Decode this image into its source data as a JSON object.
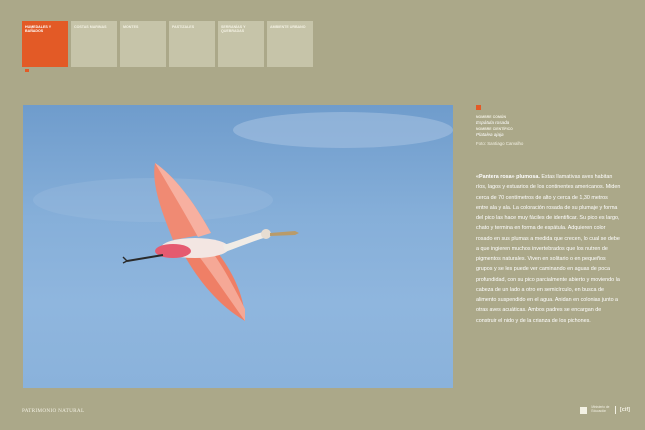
{
  "tabs": [
    {
      "label": "Humedales y bañados",
      "active": true
    },
    {
      "label": "Costas marinas",
      "active": false
    },
    {
      "label": "Montes",
      "active": false
    },
    {
      "label": "Pastizales",
      "active": false
    },
    {
      "label": "Serranías y quebradas",
      "active": false
    },
    {
      "label": "Ambiente urbano",
      "active": false
    }
  ],
  "caption": {
    "common_name_label": "Nombre común",
    "common_name": "Espátula rosada",
    "scientific_name_label": "Nombre científico",
    "scientific_name": "Platalea ajaja",
    "photo_credit": "Foto: Santiago Carvalho"
  },
  "description": {
    "lead": "«Pantera rosa» plumosa.",
    "text": " Estas llamativas aves habitan ríos, lagos y estuarios de los continentes americanos. Miden cerca de 70 centímetros de alto y cerca de 1,30 metros entre ala y ala. La coloración rosada de su plumaje y forma del pico las hace muy fáciles de identificar. Su pico es largo, chato y termina en forma de espátula. Adquieren color rosado en sus plumas a medida que crecen, lo cual se debe a que ingieren muchos invertebrados que los nutren de pigmentos naturales. Viven en solitario o en pequeños grupos y se les puede ver caminando en aguas de poca profundidad, con su pico parcialmente abierto y moviendo la cabeza de un lado a otro en semicírculo, en busca de alimento suspendido en el agua. Anidan en colonias junto a otras aves acuáticas. Ambos padres se encargan de construir el nido y de la crianza de los pichones."
  },
  "footer": {
    "left": "Patrimonio natural",
    "logo_text": "Ministerio de Educación",
    "brand": "[cif]"
  },
  "colors": {
    "background": "#aba889",
    "accent": "#e35a26",
    "tab_inactive": "#c6c4a9"
  }
}
